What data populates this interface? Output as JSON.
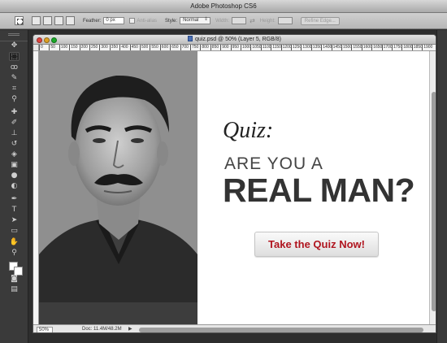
{
  "app": {
    "title": "Adobe Photoshop CS6"
  },
  "options_bar": {
    "feather_label": "Feather:",
    "feather_value": "0 px",
    "anti_alias_label": "Anti-alias",
    "style_label": "Style:",
    "style_value": "Normal",
    "width_label": "Width:",
    "height_label": "Height:",
    "refine_edge_label": "Refine Edge..."
  },
  "document": {
    "title": "quiz.psd @ 50% (Layer 5, RGB/8)",
    "ruler_ticks": [
      "0",
      "50",
      "100",
      "150",
      "200",
      "250",
      "300",
      "350",
      "400",
      "450",
      "500",
      "550",
      "600",
      "650",
      "700",
      "750",
      "800",
      "850",
      "900",
      "950",
      "1000",
      "1050",
      "1100",
      "1150",
      "1200",
      "1250",
      "1300",
      "1350",
      "1400",
      "1450",
      "1500",
      "1550",
      "1600",
      "1650",
      "1700",
      "1750",
      "1800",
      "1850",
      "1900"
    ],
    "zoom": "50%",
    "doc_info": "Doc: 11.4M/48.2M"
  },
  "canvas": {
    "quiz_label": "Quiz:",
    "headline_small": "ARE YOU A",
    "headline_big": "REAL MAN?",
    "cta_label": "Take the Quiz Now!"
  },
  "colors": {
    "cta_text": "#b0151f",
    "headline": "#333333",
    "ui_dark": "#3a3a3a"
  },
  "tools": [
    "marquee-icon",
    "move-icon",
    "lasso-icon",
    "quick-select-icon",
    "crop-icon",
    "eyedropper-icon",
    "healing-icon",
    "brush-icon",
    "stamp-icon",
    "history-brush-icon",
    "eraser-icon",
    "gradient-icon",
    "blur-icon",
    "dodge-icon",
    "pen-icon",
    "type-icon",
    "path-select-icon",
    "shape-icon",
    "hand-icon",
    "zoom-icon"
  ]
}
